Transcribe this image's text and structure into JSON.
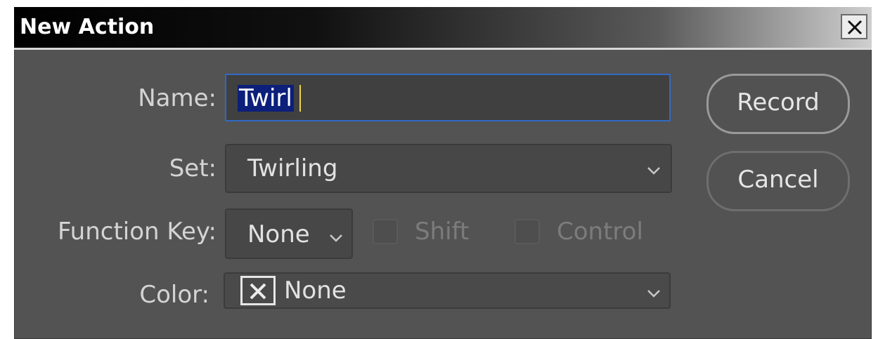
{
  "dialog": {
    "title": "New Action",
    "close_label": "close"
  },
  "form": {
    "name_label": "Name:",
    "name_value": "Twirl",
    "set_label": "Set:",
    "set_value": "Twirling",
    "function_key_label": "Function Key:",
    "function_key_value": "None",
    "shift_label": "Shift",
    "shift_checked": false,
    "control_label": "Control",
    "control_checked": false,
    "color_label": "Color:",
    "color_value": "None"
  },
  "buttons": {
    "record": "Record",
    "cancel": "Cancel"
  },
  "colors": {
    "dialog_bg": "#535353",
    "focus_border": "#2f6bc4",
    "selection_bg": "#0c1f7a"
  }
}
